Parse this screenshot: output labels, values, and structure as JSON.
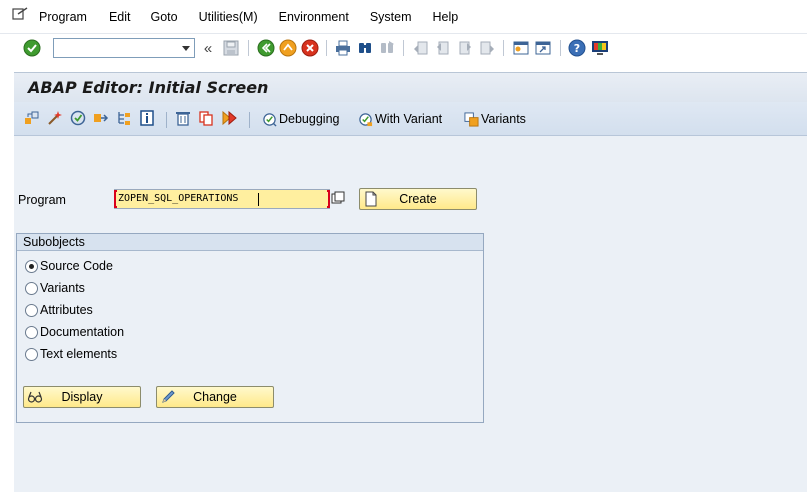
{
  "menu": {
    "items": [
      {
        "label": "Program",
        "accel": "P"
      },
      {
        "label": "Edit",
        "accel": "E"
      },
      {
        "label": "Goto",
        "accel": "G"
      },
      {
        "label": "Utilities(M)",
        "accel": "M"
      },
      {
        "label": "Environment",
        "accel": "n"
      },
      {
        "label": "System",
        "accel": "y"
      },
      {
        "label": "Help",
        "accel": "H"
      }
    ]
  },
  "toolbar": {
    "command_value": "",
    "icons": [
      "enter-icon",
      "back-icon",
      "exit-icon",
      "cancel-icon",
      "print-icon",
      "find-icon",
      "find-next-icon",
      "first-page-icon",
      "previous-page-icon",
      "next-page-icon",
      "last-page-icon",
      "create-session-icon",
      "shortcut-icon",
      "help-icon",
      "customize-layout-icon"
    ]
  },
  "screen": {
    "title": "ABAP Editor: Initial Screen"
  },
  "app_toolbar": {
    "debugging_label": "Debugging",
    "with_variant_label": "With Variant",
    "variants_label": "Variants"
  },
  "form": {
    "program_label": "Program",
    "program_value": "ZOPEN_SQL_OPERATIONS",
    "create_label": "Create",
    "subobjects_title": "Subobjects",
    "options": [
      {
        "label": "Source Code",
        "selected": true
      },
      {
        "label": "Variants",
        "selected": false
      },
      {
        "label": "Attributes",
        "selected": false
      },
      {
        "label": "Documentation",
        "selected": false
      },
      {
        "label": "Text elements",
        "selected": false
      }
    ],
    "display_label": "Display",
    "change_label": "Change"
  },
  "colors": {
    "input_highlight": "#ffef9f",
    "button_fill": "#ffe98a",
    "background": "#ebf0f6",
    "required_marker": "#d9001b"
  }
}
